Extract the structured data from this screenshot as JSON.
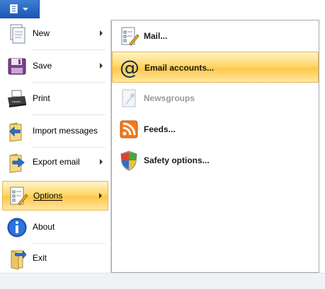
{
  "app_menu": {
    "icon": "document-menu-icon",
    "arrow": "chevron-down-icon"
  },
  "left_menu": {
    "items": [
      {
        "label": "New",
        "icon": "new-document-icon",
        "has_submenu": true,
        "highlighted": false
      },
      {
        "label": "Save",
        "icon": "floppy-disk-icon",
        "has_submenu": true,
        "highlighted": false
      },
      {
        "label": "Print",
        "icon": "printer-icon",
        "has_submenu": false,
        "highlighted": false
      },
      {
        "label": "Import messages",
        "icon": "import-folder-icon",
        "has_submenu": false,
        "highlighted": false
      },
      {
        "label": "Export email",
        "icon": "export-folder-icon",
        "has_submenu": true,
        "highlighted": false
      },
      {
        "label": "Options",
        "icon": "options-icon",
        "has_submenu": true,
        "highlighted": true
      },
      {
        "label": "About",
        "icon": "info-icon",
        "has_submenu": false,
        "highlighted": false
      },
      {
        "label": "Exit",
        "icon": "exit-icon",
        "has_submenu": false,
        "highlighted": false
      }
    ]
  },
  "submenu": {
    "items": [
      {
        "label": "Mail...",
        "icon": "mail-options-icon",
        "disabled": false,
        "highlighted": false
      },
      {
        "label": "Email accounts...",
        "icon": "at-sign-icon",
        "disabled": false,
        "highlighted": true
      },
      {
        "label": "Newsgroups",
        "icon": "newsgroups-icon",
        "disabled": true,
        "highlighted": false
      },
      {
        "label": "Feeds...",
        "icon": "rss-feed-icon",
        "disabled": false,
        "highlighted": false
      },
      {
        "label": "Safety options...",
        "icon": "shield-icon",
        "disabled": false,
        "highlighted": false
      }
    ]
  },
  "colors": {
    "highlight_top": "#fff3c8",
    "highlight_mid": "#ffd86b",
    "highlight_border": "#e8b64c",
    "menu_button": "#2a67c4",
    "disabled_text": "#9a9a9a"
  }
}
